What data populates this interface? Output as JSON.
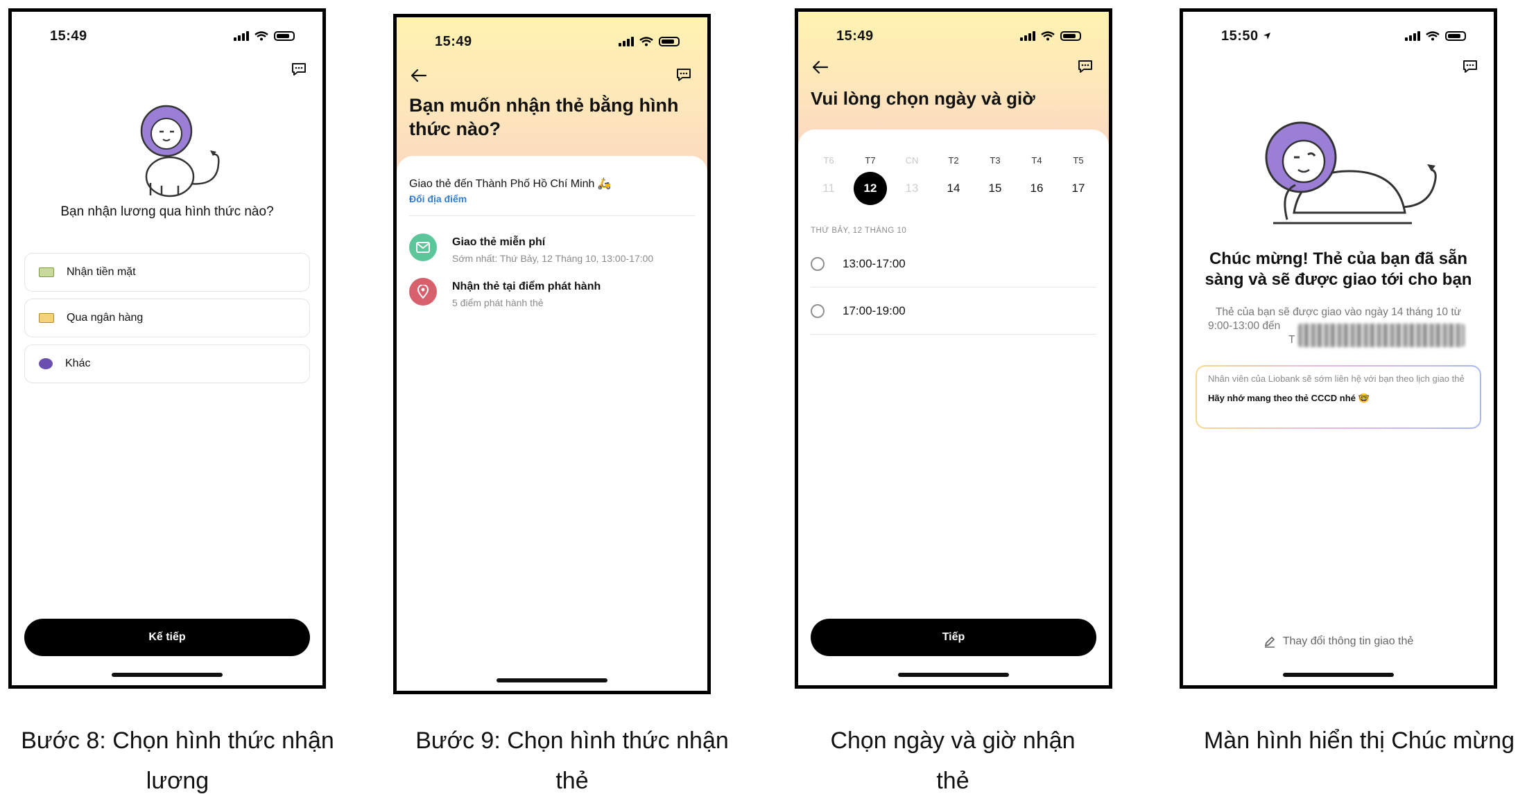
{
  "screens": {
    "s1": {
      "time": "15:49",
      "question": "Bạn nhận lương qua hình thức nào?",
      "options": [
        {
          "label": "Nhận tiền mặt",
          "icon": "cash-icon"
        },
        {
          "label": "Qua ngân hàng",
          "icon": "bank-card-icon"
        },
        {
          "label": "Khác",
          "icon": "other-icon"
        }
      ],
      "next_label": "Kế tiếp"
    },
    "s2": {
      "time": "15:49",
      "title": "Bạn muốn nhận thẻ bằng hình thức nào?",
      "location": "Giao thẻ đến Thành Phố Hồ Chí Minh 🛵",
      "change_location": "Đổi địa điểm",
      "methods": [
        {
          "title": "Giao thẻ miễn phí",
          "subtitle": "Sớm nhất: Thứ Bảy, 12 Tháng 10, 13:00-17:00",
          "icon": "mail-icon",
          "color": "#5cc69b"
        },
        {
          "title": "Nhận thẻ tại điểm phát hành",
          "subtitle": "5 điểm phát hành thẻ",
          "icon": "location-pin-icon",
          "color": "#d8606c"
        }
      ]
    },
    "s3": {
      "time": "15:49",
      "title": "Vui lòng chọn ngày và giờ",
      "day_names": [
        "T6",
        "T7",
        "CN",
        "T2",
        "T3",
        "T4",
        "T5"
      ],
      "dates": [
        "11",
        "12",
        "13",
        "14",
        "15",
        "16",
        "17"
      ],
      "disabled_index": [
        0,
        2
      ],
      "selected_date": "12",
      "date_label": "THỨ BẢY, 12 THÁNG 10",
      "slots": [
        "13:00-17:00",
        "17:00-19:00"
      ],
      "next_label": "Tiếp"
    },
    "s4": {
      "time": "15:50",
      "title": "Chúc mừng! Thẻ của bạn đã sẵn sàng và sẽ được giao tới cho bạn",
      "desc_line1": "Thẻ của bạn sẽ được giao vào ngày 14 tháng 10 từ",
      "desc_line2": "9:00-13:00 đến",
      "desc_line3": "T",
      "note_line1": "Nhân viên của Liobank sẽ sớm liên hệ với bạn theo lịch giao thẻ",
      "note_line2": "Hãy nhớ mang theo thẻ CCCD nhé 🤓",
      "change_label": "Thay đổi thông tin giao thẻ"
    }
  },
  "captions": {
    "c1_line1": "Bước 8: Chọn hình thức nhận",
    "c1_line2": "lương",
    "c2_line1": "Bước 9: Chọn hình thức nhận",
    "c2_line2": "thẻ",
    "c3_line1": "Chọn ngày và giờ nhận",
    "c3_line2": "thẻ",
    "c4_line1": "Màn hình hiển thị Chúc mừng"
  },
  "colors": {
    "accent_blue": "#2f7dd6",
    "lion_purple": "#9b7ed6",
    "header_gradient_top": "#fff3b0",
    "header_gradient_bottom": "#fbd7c2"
  }
}
